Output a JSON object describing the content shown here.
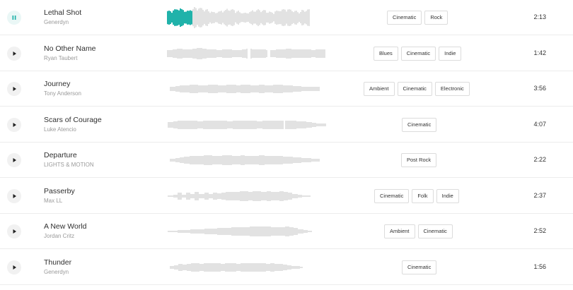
{
  "colors": {
    "accent": "#20b2aa",
    "waveform": "#e2e2e2",
    "divider": "#ececec"
  },
  "tracks": [
    {
      "title": "Lethal Shot",
      "artist": "Generdyn",
      "tags": [
        "Cinematic",
        "Rock"
      ],
      "duration": "2:13",
      "state": "playing",
      "control_icon": "pause-icon",
      "progress": 0.17
    },
    {
      "title": "No Other Name",
      "artist": "Ryan Taubert",
      "tags": [
        "Blues",
        "Cinematic",
        "Indie"
      ],
      "duration": "1:42",
      "state": "stopped",
      "control_icon": "play-icon",
      "progress": 0
    },
    {
      "title": "Journey",
      "artist": "Tony Anderson",
      "tags": [
        "Ambient",
        "Cinematic",
        "Electronic"
      ],
      "duration": "3:56",
      "state": "stopped",
      "control_icon": "play-icon",
      "progress": 0
    },
    {
      "title": "Scars of Courage",
      "artist": "Luke Atencio",
      "tags": [
        "Cinematic"
      ],
      "duration": "4:07",
      "state": "stopped",
      "control_icon": "play-icon",
      "progress": 0
    },
    {
      "title": "Departure",
      "artist": "LIGHTS & MOTION",
      "tags": [
        "Post Rock"
      ],
      "duration": "2:22",
      "state": "stopped",
      "control_icon": "play-icon",
      "progress": 0
    },
    {
      "title": "Passerby",
      "artist": "Max LL",
      "tags": [
        "Cinematic",
        "Folk",
        "Indie"
      ],
      "duration": "2:37",
      "state": "stopped",
      "control_icon": "play-icon",
      "progress": 0
    },
    {
      "title": "A New World",
      "artist": "Jordan Critz",
      "tags": [
        "Ambient",
        "Cinematic"
      ],
      "duration": "2:52",
      "state": "stopped",
      "control_icon": "play-icon",
      "progress": 0
    },
    {
      "title": "Thunder",
      "artist": "Generdyn",
      "tags": [
        "Cinematic"
      ],
      "duration": "1:56",
      "state": "stopped",
      "control_icon": "play-icon",
      "progress": 0
    }
  ]
}
